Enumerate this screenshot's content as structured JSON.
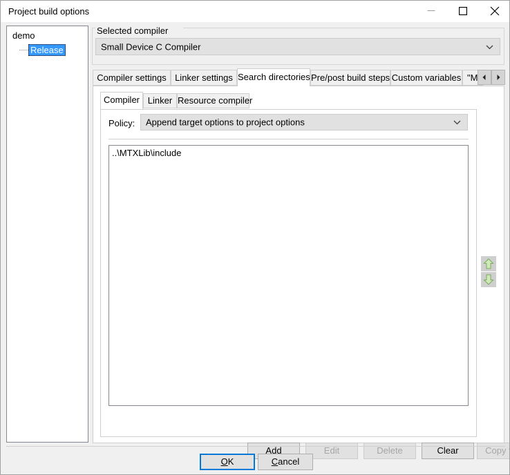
{
  "window": {
    "title": "Project build options",
    "controls": {
      "minimize": "minimize-icon",
      "maximize": "maximize-icon",
      "close": "close-icon"
    }
  },
  "tree": {
    "root_label": "demo",
    "selected_label": "Release"
  },
  "compiler_group": {
    "legend": "Selected compiler",
    "selected_value": "Small Device C Compiler"
  },
  "outer_tabs": {
    "items": [
      {
        "label": "Compiler settings",
        "active": false
      },
      {
        "label": "Linker settings",
        "active": false
      },
      {
        "label": "Search directories",
        "active": true
      },
      {
        "label": "Pre/post build steps",
        "active": false
      },
      {
        "label": "Custom variables",
        "active": false
      },
      {
        "label": "\"Make\"",
        "active": false
      }
    ],
    "scroll_left": "chevron-left-icon",
    "scroll_right": "chevron-right-icon"
  },
  "inner_tabs": {
    "items": [
      {
        "label": "Compiler",
        "active": true
      },
      {
        "label": "Linker",
        "active": false
      },
      {
        "label": "Resource compiler",
        "active": false
      }
    ]
  },
  "policy": {
    "label": "Policy:",
    "selected_value": "Append target options to project options"
  },
  "directories": {
    "items": [
      "..\\MTXLib\\include"
    ]
  },
  "order_buttons": {
    "move_up": "arrow-up-icon",
    "move_down": "arrow-down-icon"
  },
  "action_buttons": {
    "add": "Add",
    "edit": "Edit",
    "delete": "Delete",
    "clear": "Clear",
    "copy_to": "Copy to..."
  },
  "dialog_buttons": {
    "ok_prefix": "",
    "ok_accel": "O",
    "ok_suffix": "K",
    "cancel_accel": "C",
    "cancel_suffix": "ancel"
  },
  "colors": {
    "selection": "#3399ff",
    "focus_border": "#0078d7",
    "arrow_green": "#8fc97a",
    "dialog_bg": "#f0f0f0"
  }
}
